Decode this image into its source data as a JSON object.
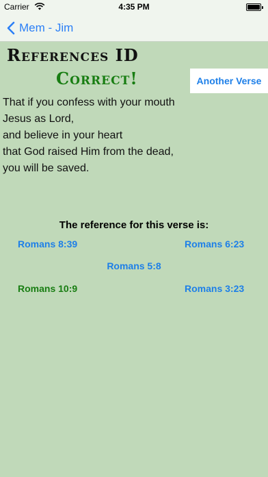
{
  "status_bar": {
    "carrier": "Carrier",
    "time": "4:35 PM",
    "battery_level": 1.0
  },
  "nav": {
    "back_label": "Mem - Jim",
    "back_icon": "chevron-left-icon"
  },
  "screen": {
    "title": "References ID",
    "result": "Correct!",
    "another_verse_label": "Another Verse"
  },
  "verse": {
    "lines": [
      "That if you confess with your mouth",
      "Jesus as Lord,",
      "and believe in your heart",
      "that God raised Him from the dead,",
      "you will be saved."
    ]
  },
  "quiz": {
    "prompt": "The reference for this verse is:",
    "choices": [
      {
        "label": "Romans 8:39",
        "correct": false
      },
      {
        "label": "Romans 6:23",
        "correct": false
      },
      {
        "label": "Romans 5:8",
        "correct": false
      },
      {
        "label": "Romans 10:9",
        "correct": true
      },
      {
        "label": "Romans 3:23",
        "correct": false
      }
    ]
  },
  "colors": {
    "background": "#c0d9b9",
    "accent_blue": "#1d7fe8",
    "correct_green": "#187d12"
  }
}
